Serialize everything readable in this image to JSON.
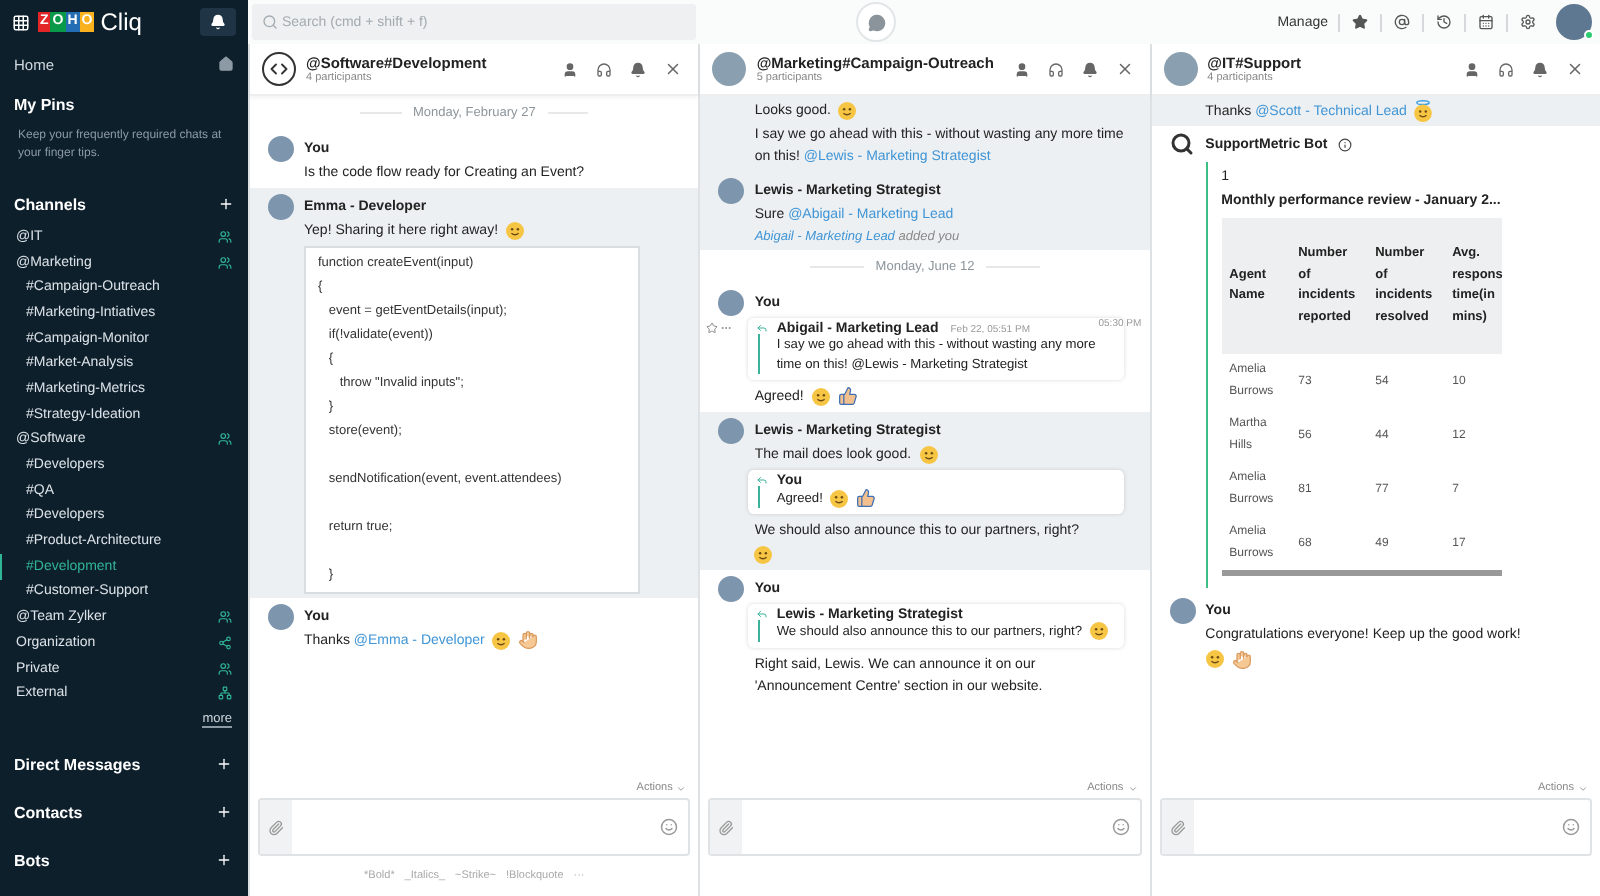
{
  "sidebar": {
    "logo": {
      "brand": "ZOHO",
      "product": "Cliq"
    },
    "home": "Home",
    "pins": {
      "title": "My Pins",
      "hint": "Keep your frequently required chats at your finger tips."
    },
    "channels_title": "Channels",
    "channels": [
      {
        "label": "@IT",
        "kind": "team",
        "selected": false
      },
      {
        "label": "@Marketing",
        "kind": "team",
        "selected": false,
        "children": [
          {
            "label": "#Campaign-Outreach",
            "selected": false
          },
          {
            "label": "#Marketing-Intiatives",
            "selected": false
          },
          {
            "label": "#Campaign-Monitor",
            "selected": false
          },
          {
            "label": "#Market-Analysis",
            "selected": false
          },
          {
            "label": "#Marketing-Metrics",
            "selected": false
          },
          {
            "label": "#Strategy-Ideation",
            "selected": false
          }
        ]
      },
      {
        "label": "@Software",
        "kind": "team",
        "selected": false,
        "children": [
          {
            "label": "#Developers",
            "selected": false
          },
          {
            "label": "#QA",
            "selected": false
          },
          {
            "label": "#Developers",
            "selected": false
          },
          {
            "label": "#Product-Architecture",
            "selected": false
          },
          {
            "label": "#Development",
            "selected": true
          },
          {
            "label": "#Customer-Support",
            "selected": false
          }
        ]
      },
      {
        "label": "@Team Zylker",
        "kind": "team",
        "selected": false
      },
      {
        "label": "Organization",
        "kind": "organization",
        "selected": false
      },
      {
        "label": "Private",
        "kind": "team",
        "selected": false
      },
      {
        "label": "External",
        "kind": "external",
        "selected": false
      }
    ],
    "more": "more",
    "sections": [
      "Direct Messages",
      "Contacts",
      "Bots"
    ]
  },
  "topbar": {
    "search": {
      "placeholder": "Search (cmd + shift + f)"
    },
    "manage": "Manage"
  },
  "panes": [
    {
      "title": "@Software#Development",
      "participants": "4 participants",
      "avatar": {
        "kind": "code"
      },
      "actions": "Actions",
      "format_hints": [
        "*Bold*",
        "_Italics_",
        "~Strike~",
        "!Blockquote",
        "···"
      ],
      "messages": [
        {
          "kind": "date",
          "label": "Monday, February 27"
        },
        {
          "kind": "message",
          "author": "You",
          "avatar": {
            "kind": "person"
          },
          "highlighted": false,
          "blocks": [
            {
              "kind": "text",
              "parts": [
                {
                  "text": "Is the  code flow ready for Creating an Event?"
                }
              ]
            }
          ]
        },
        {
          "kind": "message",
          "author": "Emma - Developer",
          "avatar": {
            "kind": "person"
          },
          "highlighted": true,
          "blocks": [
            {
              "kind": "text",
              "parts": [
                {
                  "text": "Yep! Sharing it here right away!"
                }
              ],
              "emoji": [
                {
                  "kind": "smile"
                }
              ]
            },
            {
              "kind": "code",
              "lines": [
                {
                  "kind": "line",
                  "text": "function createEvent(input)"
                },
                {
                  "kind": "line",
                  "text": "{"
                },
                {
                  "kind": "line",
                  "text": "   event = getEventDetails(input);"
                },
                {
                  "kind": "line",
                  "text": "   if(!validate(event))"
                },
                {
                  "kind": "line",
                  "text": "   {"
                },
                {
                  "kind": "line",
                  "text": "      throw \"Invalid inputs\";"
                },
                {
                  "kind": "line",
                  "text": "   }"
                },
                {
                  "kind": "line",
                  "text": "   store(event);"
                },
                {
                  "kind": "blank"
                },
                {
                  "kind": "line",
                  "text": "   sendNotification(event, event.attendees)"
                },
                {
                  "kind": "blank"
                },
                {
                  "kind": "line",
                  "text": "   return true;"
                },
                {
                  "kind": "blank"
                },
                {
                  "kind": "line",
                  "text": "   }"
                }
              ]
            }
          ]
        },
        {
          "kind": "message",
          "author": "You",
          "avatar": {
            "kind": "person"
          },
          "highlighted": false,
          "blocks": [
            {
              "kind": "text",
              "parts": [
                {
                  "text": "Thanks "
                },
                {
                  "mention": "@Emma - Developer"
                }
              ],
              "emoji": [
                {
                  "kind": "smile"
                },
                {
                  "kind": "ok-hand"
                }
              ]
            }
          ]
        }
      ]
    },
    {
      "title": "@Marketing#Campaign-Outreach",
      "participants": "5 participants",
      "avatar": {
        "kind": "photo"
      },
      "actions": "Actions",
      "messages": [
        {
          "kind": "message",
          "highlighted": true,
          "blocks": [
            {
              "kind": "text",
              "parts": [
                {
                  "text": "Looks good."
                }
              ],
              "emoji": [
                {
                  "kind": "smile"
                }
              ]
            },
            {
              "kind": "text",
              "parts": [
                {
                  "text": "I say we go ahead with this - without wasting any more time on this! "
                },
                {
                  "mention": "@Lewis - Marketing Strategist"
                }
              ]
            }
          ]
        },
        {
          "kind": "message",
          "author": "Lewis - Marketing Strategist",
          "avatar": {
            "kind": "person"
          },
          "highlighted": true,
          "blocks": [
            {
              "kind": "text",
              "parts": [
                {
                  "text": "Sure "
                },
                {
                  "mention": "@Abigail - Marketing Lead"
                }
              ]
            }
          ]
        },
        {
          "kind": "system",
          "highlighted": true,
          "parts": [
            {
              "mention": "Abigail - Marketing Lead"
            },
            {
              "text": " added you"
            }
          ]
        },
        {
          "kind": "date",
          "label": "Monday, June 12"
        },
        {
          "kind": "message",
          "author": "You",
          "avatar": {
            "kind": "person"
          },
          "highlighted": false,
          "hover_time": "05:30 PM",
          "blocks": [
            {
              "kind": "quote",
              "author": "Abigail - Marketing Lead",
              "time": "Feb 22, 05:51 PM",
              "parts": [
                {
                  "text": "I say we go ahead with this - without wasting any more time on this! @Lewis - Marketing Strategist"
                }
              ]
            },
            {
              "kind": "text",
              "parts": [
                {
                  "text": "Agreed!"
                }
              ],
              "emoji": [
                {
                  "kind": "smile"
                },
                {
                  "kind": "thumbs-up"
                }
              ]
            }
          ]
        },
        {
          "kind": "message",
          "author": "Lewis - Marketing Strategist",
          "avatar": {
            "kind": "person"
          },
          "highlighted": true,
          "blocks": [
            {
              "kind": "text",
              "parts": [
                {
                  "text": "The mail does look good."
                }
              ],
              "emoji": [
                {
                  "kind": "smile"
                }
              ]
            },
            {
              "kind": "quote",
              "author": "You",
              "parts": [
                {
                  "text": "Agreed!"
                }
              ],
              "emoji": [
                {
                  "kind": "smile"
                },
                {
                  "kind": "thumbs-up"
                }
              ]
            },
            {
              "kind": "text",
              "parts": [
                {
                  "text": "We should also announce this to our partners, right?"
                }
              ]
            },
            {
              "kind": "emoji",
              "emoji": [
                {
                  "kind": "smile"
                }
              ]
            }
          ]
        },
        {
          "kind": "message",
          "author": "You",
          "avatar": {
            "kind": "person"
          },
          "highlighted": false,
          "blocks": [
            {
              "kind": "quote",
              "author": "Lewis - Marketing Strategist",
              "parts": [
                {
                  "text": "We should also announce this to our partners, right?"
                }
              ],
              "emoji": [
                {
                  "kind": "smile"
                }
              ]
            },
            {
              "kind": "text",
              "parts": [
                {
                  "text": "Right said, Lewis. We can announce it on our 'Announcement Centre' section in our website."
                }
              ]
            }
          ]
        }
      ]
    },
    {
      "title": "@IT#Support",
      "participants": "4 participants",
      "avatar": {
        "kind": "photo"
      },
      "actions": "Actions",
      "messages": [
        {
          "kind": "message",
          "highlighted": true,
          "blocks": [
            {
              "kind": "text",
              "parts": [
                {
                  "text": "Thanks "
                },
                {
                  "mention": "@Scott - Technical Lead"
                }
              ],
              "emoji": [
                {
                  "kind": "angel"
                }
              ]
            }
          ]
        },
        {
          "kind": "message",
          "author": "SupportMetric Bot",
          "avatar": {
            "kind": "bot"
          },
          "highlighted": false,
          "blocks": [
            {
              "kind": "card",
              "number": "1",
              "title": "Monthly performance review - January 2...",
              "table": {
                "columns": [
                  "Agent Name",
                  "Number of incidents reported",
                  "Number of incidents resolved",
                  "Avg. respons time(in mins)"
                ],
                "rows": [
                  [
                    "Amelia Burrows",
                    "73",
                    "54",
                    "10"
                  ],
                  [
                    "Martha Hills",
                    "56",
                    "44",
                    "12"
                  ],
                  [
                    "Amelia Burrows",
                    "81",
                    "77",
                    "7"
                  ],
                  [
                    "Amelia Burrows",
                    "68",
                    "49",
                    "17"
                  ]
                ]
              }
            }
          ]
        },
        {
          "kind": "message",
          "author": "You",
          "avatar": {
            "kind": "person"
          },
          "highlighted": false,
          "blocks": [
            {
              "kind": "text",
              "parts": [
                {
                  "text": "Congratulations everyone! Keep up the good work!"
                }
              ]
            },
            {
              "kind": "emoji",
              "emoji": [
                {
                  "kind": "smile"
                },
                {
                  "kind": "clap"
                }
              ]
            }
          ]
        }
      ]
    }
  ]
}
